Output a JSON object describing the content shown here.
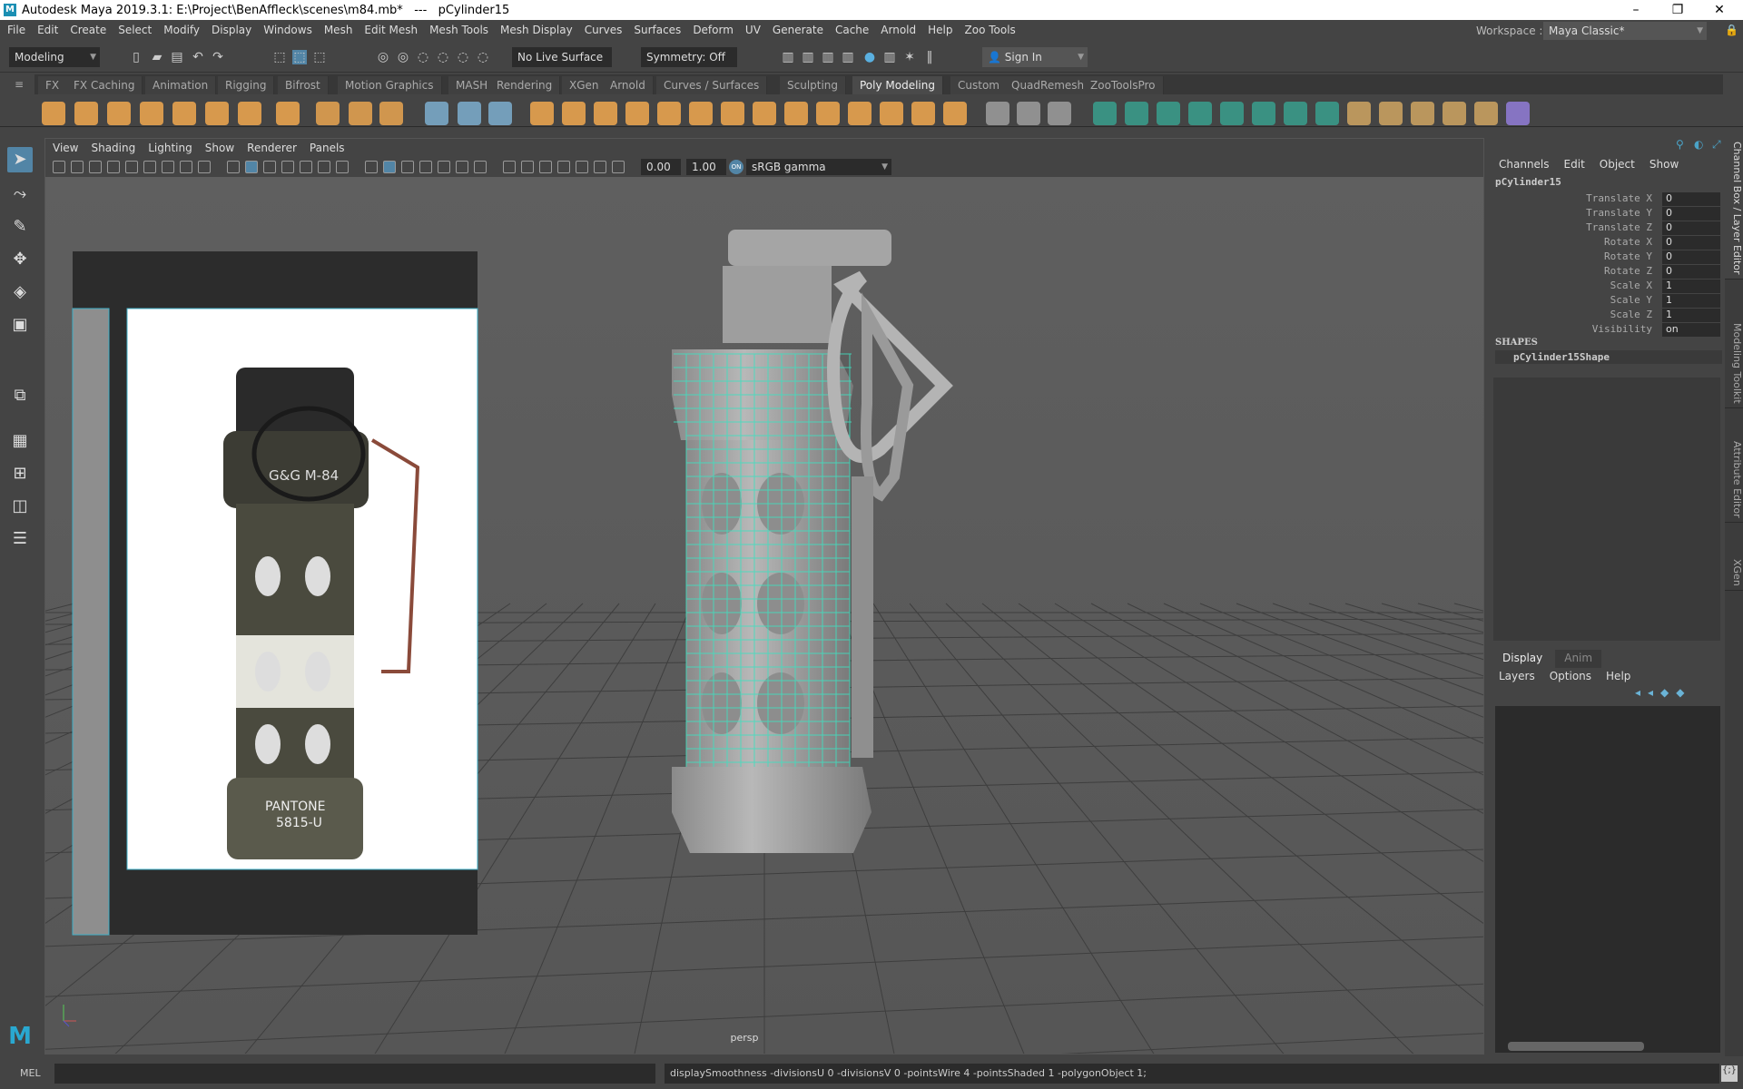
{
  "window": {
    "title": "Autodesk Maya 2019.3.1: E:\\Project\\BenAffleck\\scenes\\m84.mb*   ---   pCylinder15",
    "minimize": "–",
    "restore": "❐",
    "close": "✕"
  },
  "menus": [
    "File",
    "Edit",
    "Create",
    "Select",
    "Modify",
    "Display",
    "Windows",
    "Mesh",
    "Edit Mesh",
    "Mesh Tools",
    "Mesh Display",
    "Curves",
    "Surfaces",
    "Deform",
    "UV",
    "Generate",
    "Cache",
    "Arnold",
    "Help",
    "Zoo Tools"
  ],
  "status": {
    "mode": "Modeling",
    "live_surface": "No Live Surface",
    "symmetry": "Symmetry: Off",
    "sign_in": "Sign In",
    "workspace_label": "Workspace :",
    "workspace": "Maya Classic*"
  },
  "shelf_tabs": [
    "FX",
    "FX Caching",
    "Animation",
    "Rigging",
    "Bifrost",
    "Motion Graphics",
    "MASH",
    "Rendering",
    "XGen",
    "Arnold",
    "Curves / Surfaces",
    "Sculpting",
    "Poly Modeling",
    "Custom",
    "QuadRemesh",
    "ZooToolsPro"
  ],
  "shelf_active": "Poly Modeling",
  "colors": {
    "accent": "#5285a6",
    "wire": "#3fe0c0",
    "shelf_orange": "#e8a34f",
    "shelf_teal": "#3a9a8a"
  },
  "viewport": {
    "menus": [
      "View",
      "Shading",
      "Lighting",
      "Show",
      "Renderer",
      "Panels"
    ],
    "exposure": "0.00",
    "gamma": "1.00",
    "color_space": "sRGB gamma",
    "camera": "persp"
  },
  "reference_image": {
    "label1": "G&G M-84",
    "label2": "PANTONE",
    "label3": "5815-U"
  },
  "channel_box": {
    "menus": [
      "Channels",
      "Edit",
      "Object",
      "Show"
    ],
    "object": "pCylinder15",
    "attributes": [
      {
        "name": "Translate X",
        "value": "0"
      },
      {
        "name": "Translate Y",
        "value": "0"
      },
      {
        "name": "Translate Z",
        "value": "0"
      },
      {
        "name": "Rotate X",
        "value": "0"
      },
      {
        "name": "Rotate Y",
        "value": "0"
      },
      {
        "name": "Rotate Z",
        "value": "0"
      },
      {
        "name": "Scale X",
        "value": "1"
      },
      {
        "name": "Scale Y",
        "value": "1"
      },
      {
        "name": "Scale Z",
        "value": "1"
      },
      {
        "name": "Visibility",
        "value": "on"
      }
    ],
    "shapes_header": "SHAPES",
    "shape": "pCylinder15Shape"
  },
  "layer_editor": {
    "tabs": [
      "Display",
      "Anim"
    ],
    "menus": [
      "Layers",
      "Options",
      "Help"
    ]
  },
  "side_tabs": [
    "Channel Box / Layer Editor",
    "Modeling Toolkit",
    "Attribute Editor",
    "XGen"
  ],
  "command": {
    "language": "MEL",
    "input": "",
    "feedback": "displaySmoothness -divisionsU 0 -divisionsV 0 -pointsWire 4 -pointsShaded 1 -polygonObject 1;"
  }
}
